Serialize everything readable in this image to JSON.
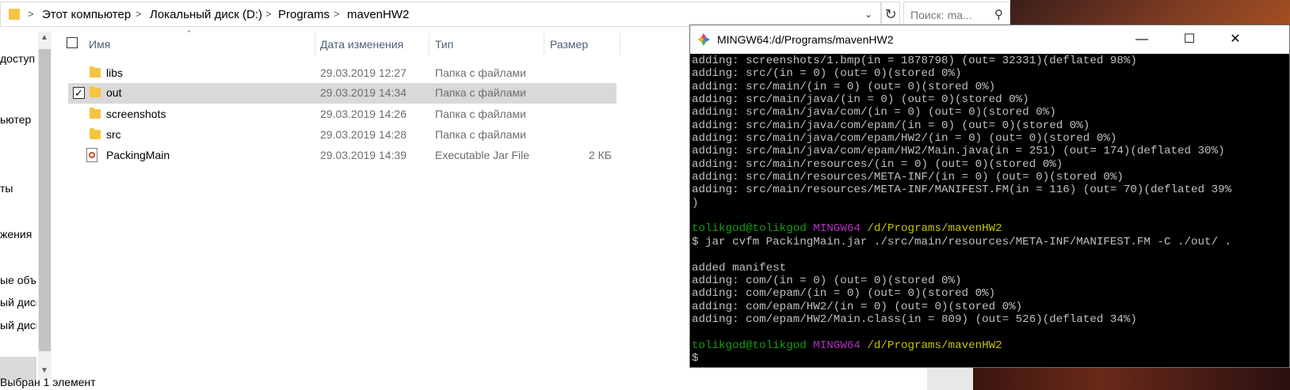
{
  "explorer": {
    "breadcrumb": [
      "Этот компьютер",
      "Локальный диск (D:)",
      "Programs",
      "mavenHW2"
    ],
    "search_placeholder": "Поиск: ma...",
    "nav_items": [
      "доступ",
      "ьютер",
      "ты",
      "жения",
      "ые объе",
      "ый дисн",
      "ый дисн"
    ],
    "status": "Выбран 1 элемент",
    "columns": {
      "name": "Имя",
      "date": "Дата изменения",
      "type": "Тип",
      "size": "Размер"
    },
    "rows": [
      {
        "name": "libs",
        "date": "29.03.2019 12:27",
        "type": "Папка с файлами",
        "size": "",
        "icon": "folder-icon",
        "selected": false
      },
      {
        "name": "out",
        "date": "29.03.2019 14:34",
        "type": "Папка с файлами",
        "size": "",
        "icon": "folder-icon",
        "selected": true
      },
      {
        "name": "screenshots",
        "date": "29.03.2019 14:26",
        "type": "Папка с файлами",
        "size": "",
        "icon": "folder-icon",
        "selected": false
      },
      {
        "name": "src",
        "date": "29.03.2019 14:28",
        "type": "Папка с файлами",
        "size": "",
        "icon": "folder-icon",
        "selected": false
      },
      {
        "name": "PackingMain",
        "date": "29.03.2019 14:39",
        "type": "Executable Jar File",
        "size": "2 КБ",
        "icon": "jar-file-icon",
        "selected": false
      }
    ]
  },
  "terminal": {
    "title": "MINGW64:/d/Programs/mavenHW2",
    "colors": {
      "user": "#13a10e",
      "mingw": "#b52fc4",
      "path": "#c8c400",
      "text": "#c0c0c0"
    },
    "lines": [
      "adding: screenshots/1.bmp(in = 1878798) (out= 32331)(deflated 98%)",
      "adding: src/(in = 0) (out= 0)(stored 0%)",
      "adding: src/main/(in = 0) (out= 0)(stored 0%)",
      "adding: src/main/java/(in = 0) (out= 0)(stored 0%)",
      "adding: src/main/java/com/(in = 0) (out= 0)(stored 0%)",
      "adding: src/main/java/com/epam/(in = 0) (out= 0)(stored 0%)",
      "adding: src/main/java/com/epam/HW2/(in = 0) (out= 0)(stored 0%)",
      "adding: src/main/java/com/epam/HW2/Main.java(in = 251) (out= 174)(deflated 30%)",
      "adding: src/main/resources/(in = 0) (out= 0)(stored 0%)",
      "adding: src/main/resources/META-INF/(in = 0) (out= 0)(stored 0%)",
      "adding: src/main/resources/META-INF/MANIFEST.FM(in = 116) (out= 70)(deflated 39%",
      ")",
      "",
      "PROMPT",
      "$ jar cvfm PackingMain.jar ./src/main/resources/META-INF/MANIFEST.FM -C ./out/ .",
      "",
      "added manifest",
      "adding: com/(in = 0) (out= 0)(stored 0%)",
      "adding: com/epam/(in = 0) (out= 0)(stored 0%)",
      "adding: com/epam/HW2/(in = 0) (out= 0)(stored 0%)",
      "adding: com/epam/HW2/Main.class(in = 809) (out= 526)(deflated 34%)",
      "",
      "PROMPT",
      "$"
    ],
    "prompt": {
      "user": "tolikgod@tolikgod",
      "env": "MINGW64",
      "path": "/d/Programs/mavenHW2"
    }
  }
}
